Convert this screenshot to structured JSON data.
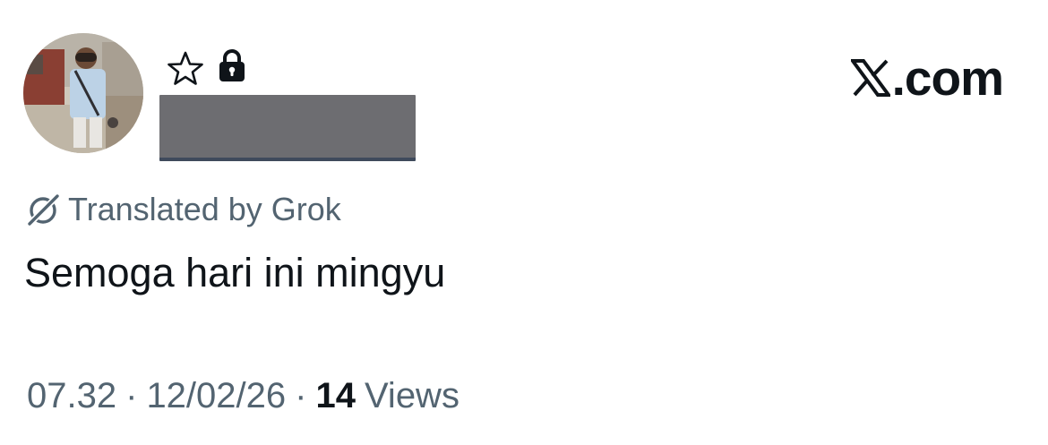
{
  "header": {
    "avatar_icon": "profile-photo",
    "badge_icons": [
      "star-icon",
      "lock-icon"
    ],
    "brand_text": "X.com",
    "brand_logo_letter": "X"
  },
  "translation": {
    "label": "Translated by Grok",
    "icon": "grok-icon"
  },
  "tweet": {
    "text": "Semoga hari ini mingyu"
  },
  "meta": {
    "time": "07.32",
    "separator": "·",
    "date": "12/02/26",
    "views_count": "14",
    "views_label": "Views"
  },
  "colors": {
    "text_primary": "#0f1419",
    "text_secondary": "#536471",
    "redaction": "#6d6d71"
  }
}
